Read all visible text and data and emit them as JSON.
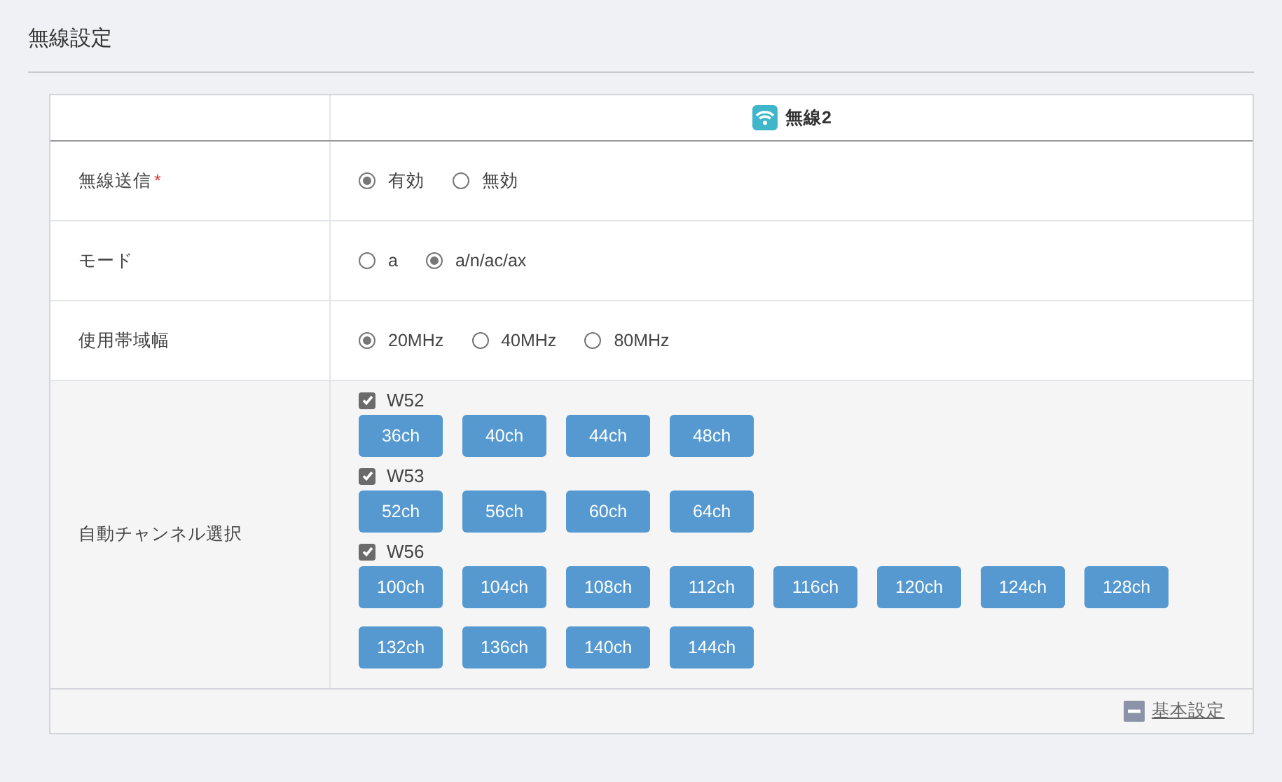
{
  "page_title": "無線設定",
  "table": {
    "header": {
      "label": "無線2"
    },
    "rows": [
      {
        "kind": "radio",
        "label": "無線送信",
        "required_mark": "*",
        "options": [
          {
            "label": "有効",
            "selected": true
          },
          {
            "label": "無効",
            "selected": false
          }
        ]
      },
      {
        "kind": "radio",
        "label": "モード",
        "options": [
          {
            "label": "a",
            "selected": false
          },
          {
            "label": "a/n/ac/ax",
            "selected": true
          }
        ]
      },
      {
        "kind": "radio",
        "label": "使用帯域幅",
        "options": [
          {
            "label": "20MHz",
            "selected": true
          },
          {
            "label": "40MHz",
            "selected": false
          },
          {
            "label": "80MHz",
            "selected": false
          }
        ]
      },
      {
        "kind": "channels",
        "label": "自動チャンネル選択",
        "groups": [
          {
            "label": "W52",
            "checked": true,
            "channels": [
              "36ch",
              "40ch",
              "44ch",
              "48ch"
            ]
          },
          {
            "label": "W53",
            "checked": true,
            "channels": [
              "52ch",
              "56ch",
              "60ch",
              "64ch"
            ]
          },
          {
            "label": "W56",
            "checked": true,
            "channels": [
              "100ch",
              "104ch",
              "108ch",
              "112ch",
              "116ch",
              "120ch",
              "124ch",
              "128ch",
              "132ch",
              "136ch",
              "140ch",
              "144ch"
            ]
          }
        ]
      }
    ]
  },
  "footer_link": {
    "label": "基本設定",
    "expanded": true
  }
}
